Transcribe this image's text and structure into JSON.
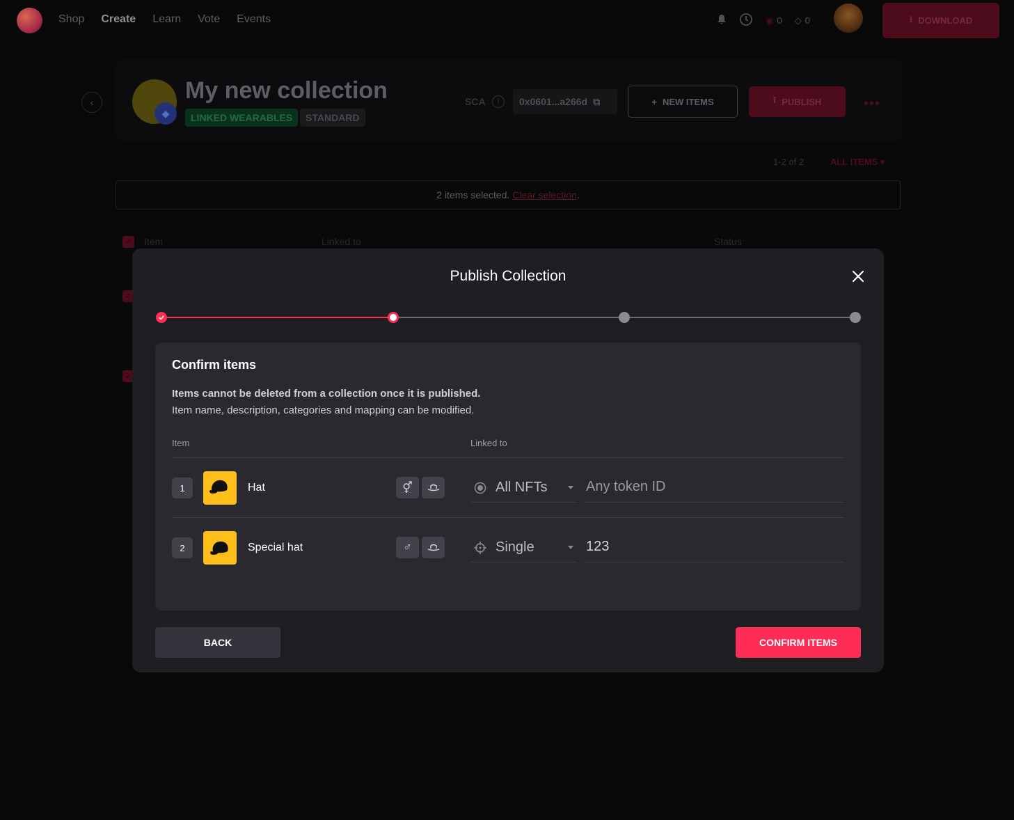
{
  "topbar": {
    "nav": [
      "Shop",
      "Create",
      "Learn",
      "Vote",
      "Events"
    ],
    "active_nav": "Create",
    "stat_mana": "0",
    "stat_land": "0",
    "download_label": "DOWNLOAD"
  },
  "collection": {
    "title": "My new collection",
    "chip_linked": "LINKED WEARABLES",
    "chip_standard": "STANDARD",
    "sca_label": "SCA",
    "sca_address": "0x0601...a266d",
    "new_items_label": "NEW ITEMS",
    "publish_label": "PUBLISH",
    "paging": "1-2 of 2",
    "filter_label": "ALL ITEMS",
    "selection_text": "2 items selected.",
    "clear_selection": "Clear selection",
    "table_headers": [
      "Item",
      "Linked to",
      "Status"
    ]
  },
  "modal": {
    "title": "Publish Collection",
    "stepper": {
      "current_step": 2,
      "total_steps": 4,
      "completed_steps": 1
    },
    "card": {
      "title": "Confirm items",
      "warning_bold": "Items cannot be deleted from a collection once it is published.",
      "warning_text": "Item name, description, categories and mapping can be modified.",
      "col_item": "Item",
      "col_linked": "Linked to",
      "rows": [
        {
          "num": "1",
          "name": "Hat",
          "gender_icon": "unisex-icon",
          "category_icon": "hat-icon",
          "mapping_icon": "radio-icon",
          "mapping_type": "All NFTs",
          "token_value": "Any token ID",
          "token_is_placeholder": true
        },
        {
          "num": "2",
          "name": "Special hat",
          "gender_icon": "male-icon",
          "category_icon": "hat-icon",
          "mapping_icon": "crosshair-icon",
          "mapping_type": "Single",
          "token_value": "123",
          "token_is_placeholder": false
        }
      ]
    },
    "back_label": "BACK",
    "confirm_label": "CONFIRM ITEMS"
  },
  "colors": {
    "accent": "#ff2d55",
    "modal_bg": "#1f1e23",
    "card_bg": "#2a2930",
    "thumb_bg": "#ffbf1a"
  }
}
